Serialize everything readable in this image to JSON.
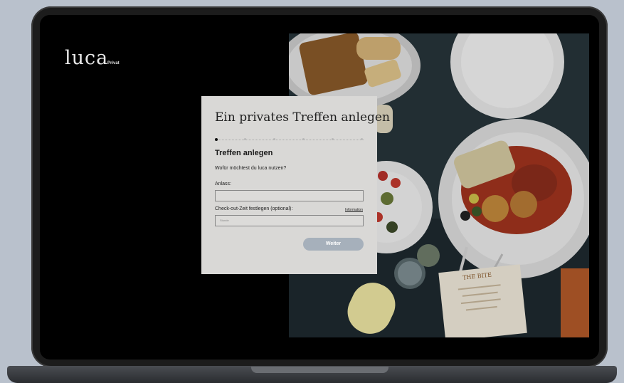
{
  "app": {
    "logo_text": "luca",
    "logo_subtitle": "Privat"
  },
  "modal": {
    "title": "Ein privates Treffen anlegen",
    "steps_total": 6,
    "steps_current": 1,
    "step_title": "Treffen anlegen",
    "question": "Wofür möchtest du luca nutzen?",
    "occasion_label": "Anlass:",
    "occasion_value": "",
    "checkout_label": "Check-out-Zeit festlegen (optional):",
    "info_link": "Information",
    "checkout_placeholder": "Stunde",
    "next_button": "Weiter"
  },
  "colors": {
    "background": "#b9c1cc",
    "screen": "#000000",
    "modal": "#d9d8d6",
    "button": "#a6b0bb"
  },
  "illustration": {
    "menu_card_text": "THE BITE"
  }
}
